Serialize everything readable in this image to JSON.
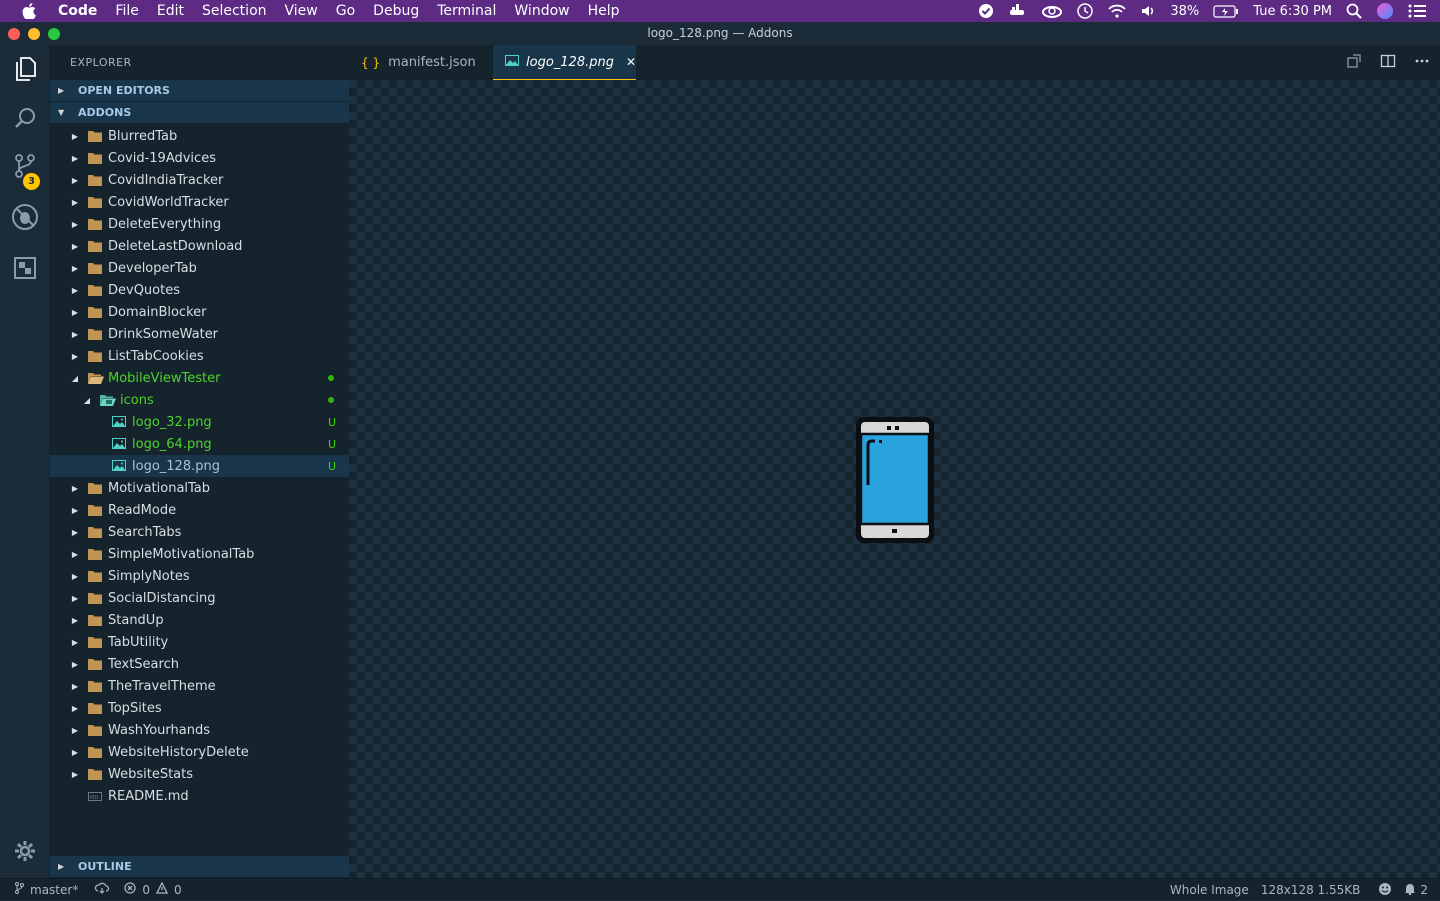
{
  "menubar": {
    "app": "Code",
    "items": [
      "File",
      "Edit",
      "Selection",
      "View",
      "Go",
      "Debug",
      "Terminal",
      "Window",
      "Help"
    ],
    "battery": "38%",
    "clock": "Tue 6:30 PM"
  },
  "window": {
    "title": "logo_128.png — Addons"
  },
  "activity": {
    "scm_badge": "3"
  },
  "sidebar": {
    "title": "EXPLORER",
    "open_editors": "OPEN EDITORS",
    "folder": "ADDONS",
    "outline": "OUTLINE",
    "tree": [
      {
        "label": "BlurredTab",
        "kind": "folder",
        "depth": 0
      },
      {
        "label": "Covid-19Advices",
        "kind": "folder",
        "depth": 0
      },
      {
        "label": "CovidIndiaTracker",
        "kind": "folder",
        "depth": 0
      },
      {
        "label": "CovidWorldTracker",
        "kind": "folder",
        "depth": 0
      },
      {
        "label": "DeleteEverything",
        "kind": "folder",
        "depth": 0
      },
      {
        "label": "DeleteLastDownload",
        "kind": "folder",
        "depth": 0
      },
      {
        "label": "DeveloperTab",
        "kind": "folder",
        "depth": 0
      },
      {
        "label": "DevQuotes",
        "kind": "folder",
        "depth": 0
      },
      {
        "label": "DomainBlocker",
        "kind": "folder",
        "depth": 0
      },
      {
        "label": "DrinkSomeWater",
        "kind": "folder",
        "depth": 0
      },
      {
        "label": "ListTabCookies",
        "kind": "folder",
        "depth": 0
      },
      {
        "label": "MobileViewTester",
        "kind": "folder-open",
        "depth": 0
      },
      {
        "label": "icons",
        "kind": "folder-open-img",
        "depth": 1
      },
      {
        "label": "logo_32.png",
        "kind": "image",
        "depth": 2,
        "status": "U"
      },
      {
        "label": "logo_64.png",
        "kind": "image",
        "depth": 2,
        "status": "U"
      },
      {
        "label": "logo_128.png",
        "kind": "image",
        "depth": 2,
        "status": "U"
      },
      {
        "label": "MotivationalTab",
        "kind": "folder",
        "depth": 0
      },
      {
        "label": "ReadMode",
        "kind": "folder",
        "depth": 0
      },
      {
        "label": "SearchTabs",
        "kind": "folder",
        "depth": 0
      },
      {
        "label": "SimpleMotivationalTab",
        "kind": "folder",
        "depth": 0
      },
      {
        "label": "SimplyNotes",
        "kind": "folder",
        "depth": 0
      },
      {
        "label": "SocialDistancing",
        "kind": "folder",
        "depth": 0
      },
      {
        "label": "StandUp",
        "kind": "folder",
        "depth": 0
      },
      {
        "label": "TabUtility",
        "kind": "folder",
        "depth": 0
      },
      {
        "label": "TextSearch",
        "kind": "folder",
        "depth": 0
      },
      {
        "label": "TheTravelTheme",
        "kind": "folder",
        "depth": 0
      },
      {
        "label": "TopSites",
        "kind": "folder",
        "depth": 0
      },
      {
        "label": "WashYourhands",
        "kind": "folder",
        "depth": 0
      },
      {
        "label": "WebsiteHistoryDelete",
        "kind": "folder",
        "depth": 0
      },
      {
        "label": "WebsiteStats",
        "kind": "folder",
        "depth": 0
      },
      {
        "label": "README.md",
        "kind": "md",
        "depth": 0
      }
    ]
  },
  "tabs": {
    "manifest": "manifest.json",
    "logo": "logo_128.png",
    "manifest_icon": "{ }"
  },
  "status": {
    "branch": "master*",
    "errors": "0",
    "warnings": "0",
    "view_mode": "Whole Image",
    "image_info": "128x128 1.55KB",
    "notifications": "2"
  },
  "colors": {
    "accent": "#ffc600",
    "git_untracked": "#3ad900",
    "menubar": "#5d2a84",
    "phone_screen": "#29a3dd"
  }
}
